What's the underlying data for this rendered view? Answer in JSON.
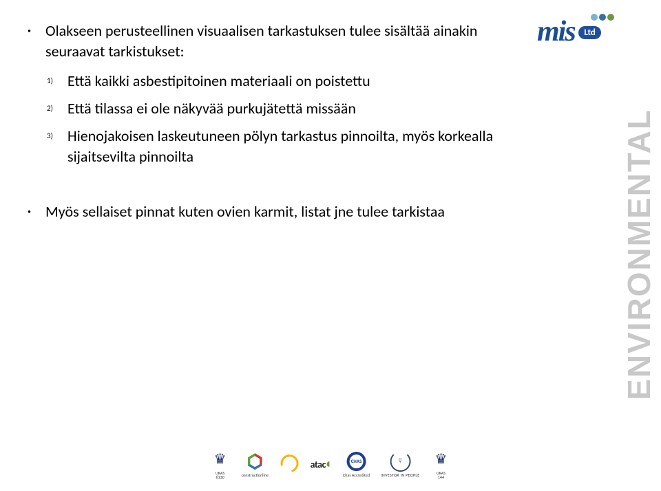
{
  "main": {
    "intro": "Olakseen perusteellinen visuaalisen tarkastuksen tulee sisältää ainakin seuraavat tarkistukset:",
    "items": [
      "Että kaikki asbestipitoinen materiaali on poistettu",
      "Että tilassa ei ole näkyvää purkujätettä missään",
      "Hienojakoisen laskeutuneen pölyn tarkastus pinnoilta, myös korkealla sijaitsevilta pinnoilta"
    ],
    "numbers": [
      "1)",
      "2)",
      "3)"
    ],
    "extra": "Myös sellaiset pinnat kuten ovien karmit, listat jne tulee tarkistaa"
  },
  "logo": {
    "text": "mis",
    "badge": "Ltd"
  },
  "side_label": "ENVIRONMENTAL",
  "footer": {
    "ukas1": {
      "label": "UKAS",
      "sub": "6130"
    },
    "cline": {
      "label": "constructionline"
    },
    "bsafe": {
      "label": ""
    },
    "atac": {
      "label": "atac"
    },
    "chas": {
      "label": "CHAS",
      "sub": "Chas Accredited"
    },
    "iip": {
      "label": "INVESTOR IN PEOPLE"
    },
    "ukas2": {
      "label": "UKAS",
      "sub": "144"
    }
  }
}
